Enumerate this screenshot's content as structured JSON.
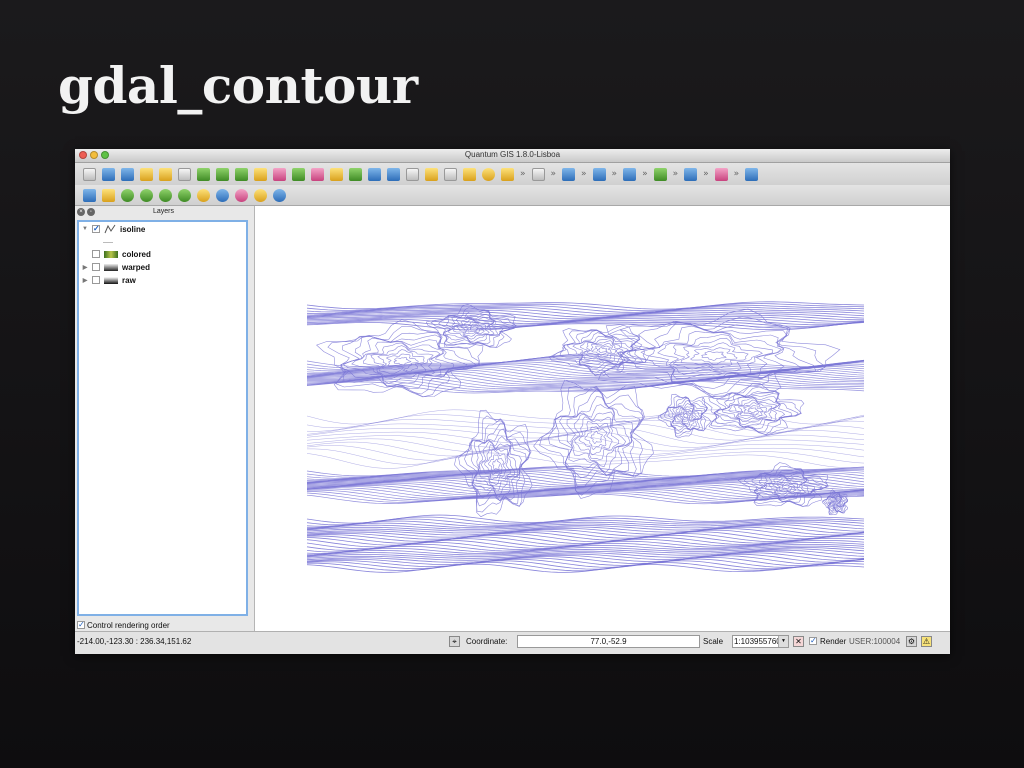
{
  "slide": {
    "title": "gdal_contour"
  },
  "window": {
    "title": "Quantum GIS 1.8.0-Lisboa"
  },
  "layers_panel": {
    "title": "Layers",
    "layers": [
      {
        "name": "isoline",
        "checked": true,
        "expanded": true,
        "icon": "vector-line-icon"
      },
      {
        "name": "colored",
        "checked": false,
        "icon": "raster-colored-icon"
      },
      {
        "name": "warped",
        "checked": false,
        "icon": "raster-warped-icon"
      },
      {
        "name": "raw",
        "checked": false,
        "icon": "raster-raw-icon"
      }
    ],
    "control_rendering_order": {
      "label": "Control rendering order",
      "checked": true
    }
  },
  "map": {
    "line_color": "#7b77d6",
    "background": "#ffffff"
  },
  "status_bar": {
    "extent": "-214.00,-123.30 : 236.34,151.62",
    "coordinate_label": "Coordinate:",
    "coordinate_value": "77.0,-52.9",
    "scale_label": "Scale",
    "scale_value": "1:103955760",
    "render_label": "Render",
    "render_checked": true,
    "crs": "USER:100004"
  }
}
